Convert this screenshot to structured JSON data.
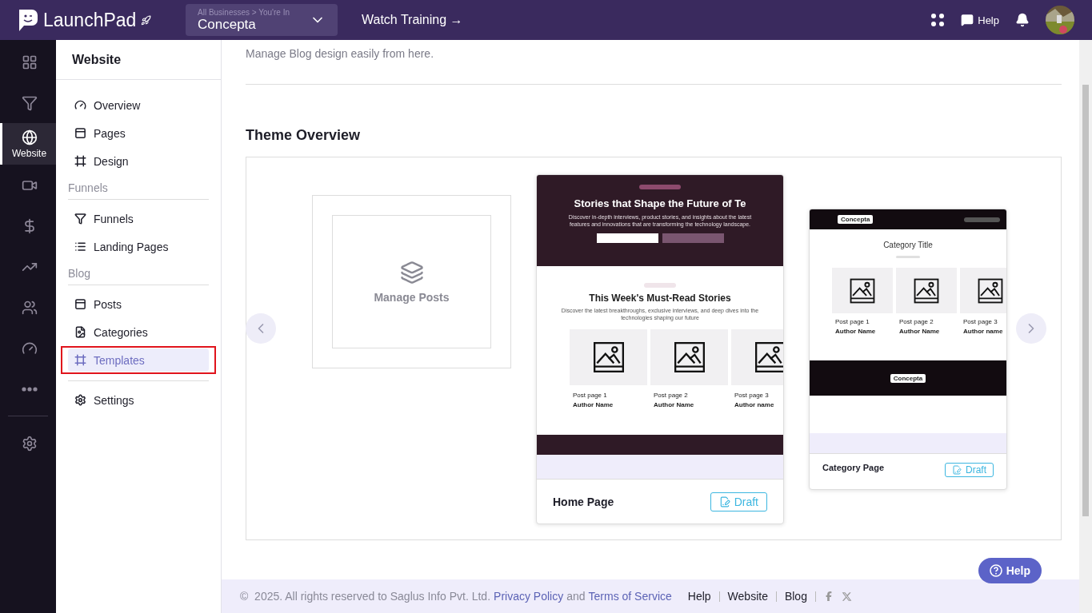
{
  "topbar": {
    "logo": "LaunchPad",
    "business_label": "All Businesses > You're In",
    "business": "Concepta",
    "training": "Watch Training →",
    "help": "Help"
  },
  "rail": [
    {
      "kind": "dashboard",
      "selected": false
    },
    {
      "kind": "funnels",
      "selected": false
    },
    {
      "kind": "website",
      "label": "Website",
      "selected": true
    },
    {
      "kind": "video",
      "selected": false
    },
    {
      "kind": "payments",
      "selected": false
    },
    {
      "kind": "sales",
      "selected": false
    },
    {
      "kind": "contacts",
      "selected": false
    },
    {
      "kind": "analytics",
      "selected": false
    },
    {
      "kind": "more",
      "selected": false
    },
    {
      "kind": "settings",
      "selected": false
    }
  ],
  "sidebar": {
    "title": "Website",
    "sections": [
      {
        "items": [
          {
            "kind": "overview",
            "label": "Overview",
            "selected": false,
            "outlined": false
          },
          {
            "kind": "pages",
            "label": "Pages",
            "selected": false,
            "outlined": false
          },
          {
            "kind": "design",
            "label": "Design",
            "selected": false,
            "outlined": false
          }
        ]
      },
      {
        "heading": "Funnels",
        "items": [
          {
            "kind": "funnels",
            "label": "Funnels",
            "selected": false,
            "outlined": false
          },
          {
            "kind": "landing",
            "label": "Landing Pages",
            "selected": false,
            "outlined": false
          }
        ]
      },
      {
        "heading": "Blog",
        "items": [
          {
            "kind": "pages",
            "label": "Posts",
            "selected": false,
            "outlined": false
          },
          {
            "kind": "categories",
            "label": "Categories",
            "selected": false,
            "outlined": false
          },
          {
            "kind": "design",
            "label": "Templates",
            "selected": true,
            "outlined": true
          }
        ]
      },
      {
        "divided": true,
        "items": [
          {
            "kind": "settings",
            "label": "Settings",
            "selected": false,
            "outlined": false
          }
        ]
      }
    ]
  },
  "main": {
    "subtitle": "Manage Blog design easily from here.",
    "section_title": "Theme Overview",
    "manage_label": "Manage Posts",
    "templates": [
      {
        "kind": "home",
        "name": "Home Page",
        "status": "Draft",
        "hero_title": "Stories that Shape the Future of Te",
        "hero_text": "Discover in-depth interviews, product stories, and insights about the latest features and innovations that are transforming the technology landscape.",
        "section_title": "This Week's Must-Read Stories",
        "section_text": "Discover the latest breakthroughs, exclusive interviews, and deep dives into the technologies shaping our future",
        "posts": [
          {
            "title": "Post page 1",
            "author": "Author Name"
          },
          {
            "title": "Post page 2",
            "author": "Author Name"
          },
          {
            "title": "Post page 3",
            "author": "Author name"
          }
        ]
      },
      {
        "kind": "category",
        "name": "Category Page",
        "status": "Draft",
        "brand": "Concepta",
        "footer_brand": "Concepta",
        "category_title": "Category Title",
        "posts": [
          {
            "title": "Post page 1",
            "author": "Author Name"
          },
          {
            "title": "Post page 2",
            "author": "Author Name"
          },
          {
            "title": "Post page 3",
            "author": "Author name"
          }
        ]
      }
    ]
  },
  "help_button": "Help",
  "footer": {
    "copyright": "©  2025. All rights reserved to Saglus Info Pvt. Ltd.",
    "privacy": "Privacy Policy",
    "and": "and",
    "terms": "Terms of Service",
    "links": [
      "Help",
      "Website",
      "Blog"
    ]
  }
}
